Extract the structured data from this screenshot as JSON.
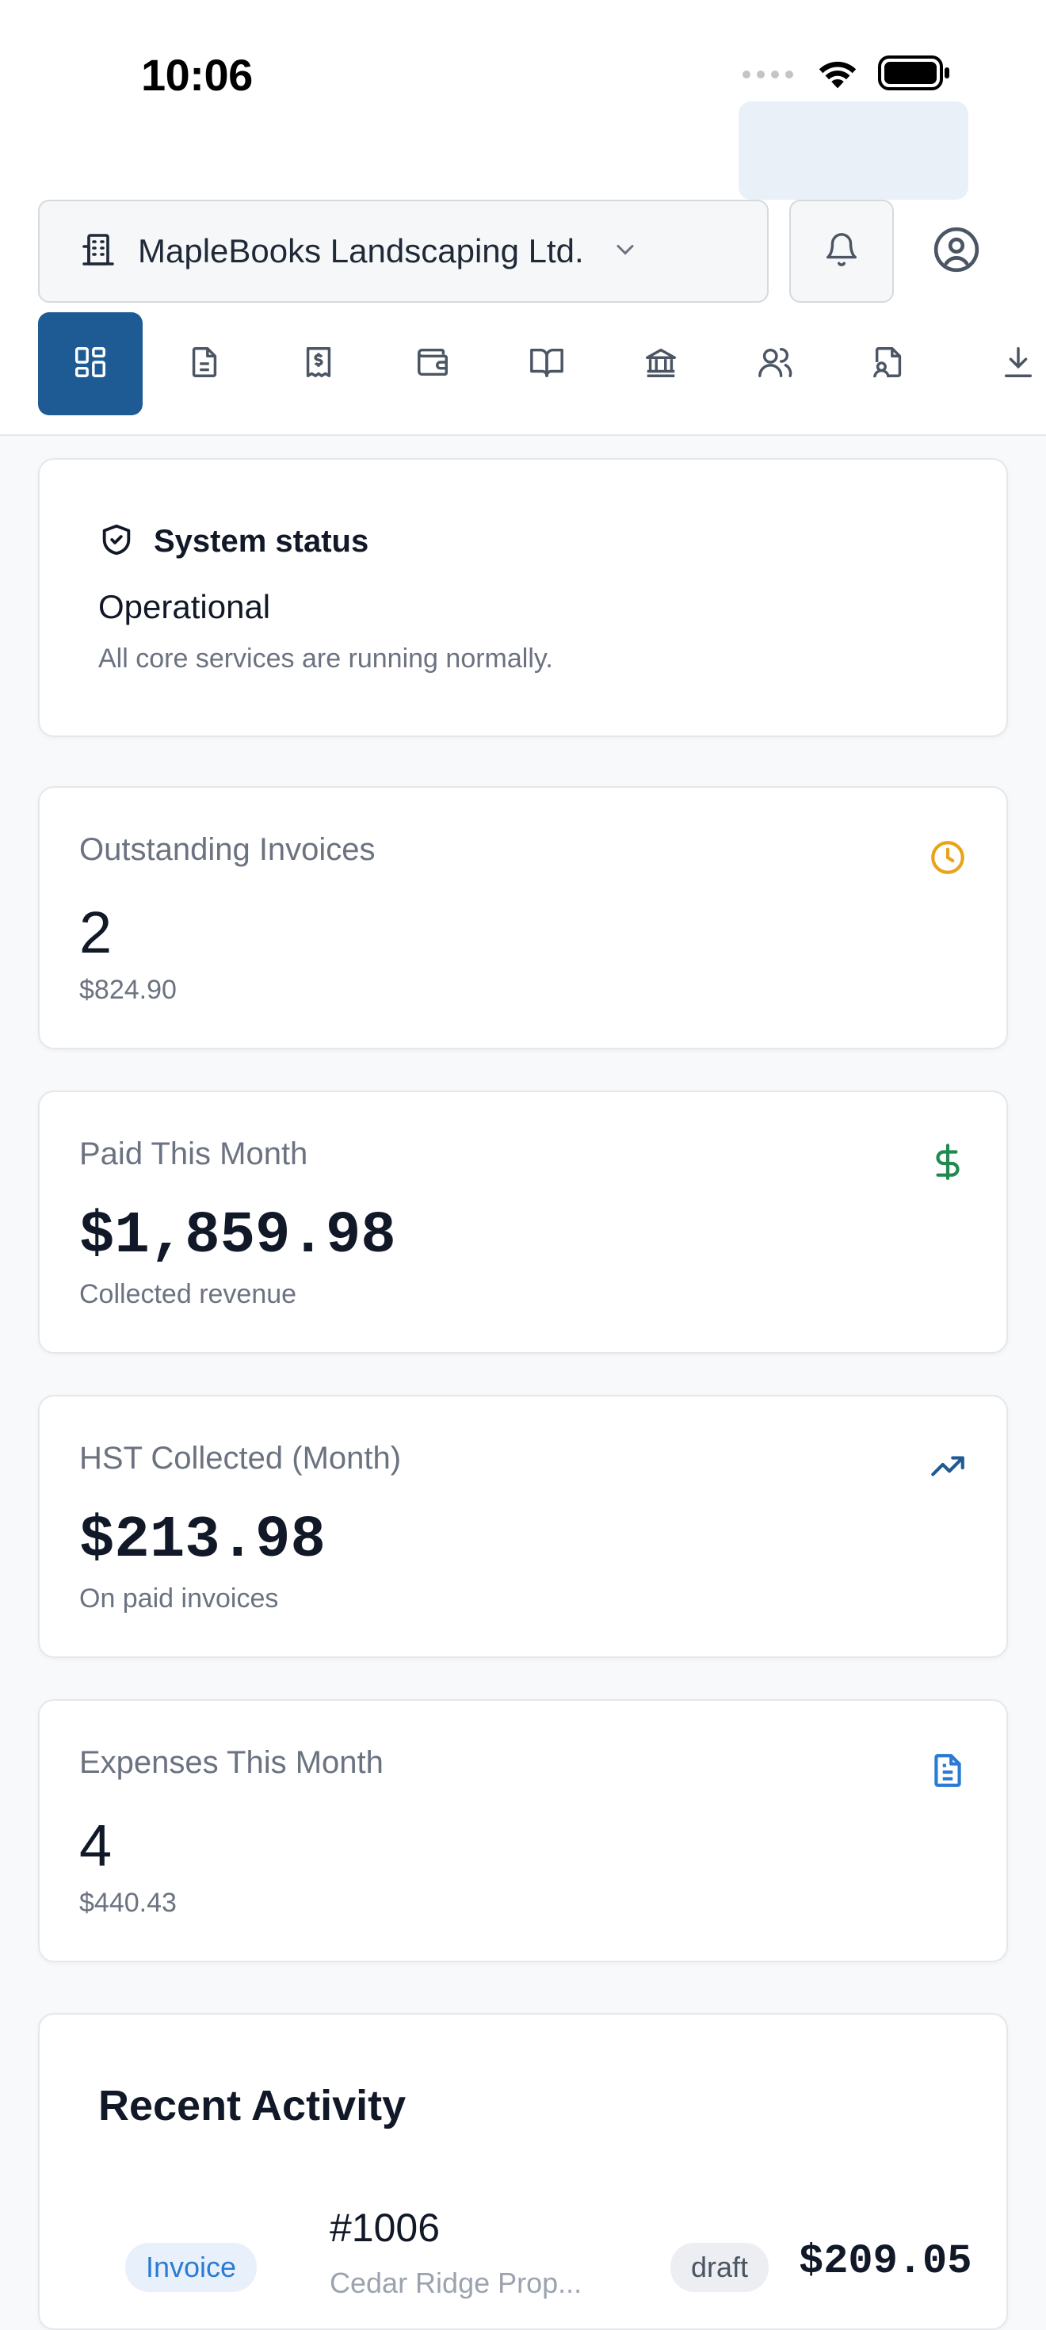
{
  "status_bar": {
    "time": "10:06"
  },
  "header": {
    "company_name": "MapleBooks Landscaping Ltd.",
    "nav_items": [
      {
        "icon": "dashboard-icon",
        "active": true
      },
      {
        "icon": "invoice-document-icon",
        "active": false
      },
      {
        "icon": "receipt-icon",
        "active": false
      },
      {
        "icon": "wallet-icon",
        "active": false
      },
      {
        "icon": "book-icon",
        "active": false
      },
      {
        "icon": "bank-icon",
        "active": false
      },
      {
        "icon": "users-icon",
        "active": false
      },
      {
        "icon": "file-user-icon",
        "active": false
      },
      {
        "icon": "download-icon",
        "active": false
      }
    ],
    "accent_color": "#1e5a94"
  },
  "system_status": {
    "title": "System status",
    "state": "Operational",
    "description": "All core services are running normally."
  },
  "stats": [
    {
      "label": "Outstanding Invoices",
      "value": "2",
      "sub": "$824.90",
      "icon": "clock-icon",
      "color": "#e8a317"
    },
    {
      "label": "Paid This Month",
      "value": "$1,859.98",
      "sub": "Collected revenue",
      "icon": "dollar-icon",
      "color": "#1f8a4c"
    },
    {
      "label": "HST Collected (Month)",
      "value": "$213.98",
      "sub": "On paid invoices",
      "icon": "trending-up-icon",
      "color": "#1e5a94"
    },
    {
      "label": "Expenses This Month",
      "value": "4",
      "sub": "$440.43",
      "icon": "file-text-icon",
      "color": "#2b7bd4"
    }
  ],
  "recent_activity": {
    "title": "Recent Activity",
    "items": [
      {
        "type": "Invoice",
        "number": "#1006",
        "client": "Cedar Ridge Prop...",
        "status": "draft",
        "amount": "$209.05"
      }
    ]
  }
}
